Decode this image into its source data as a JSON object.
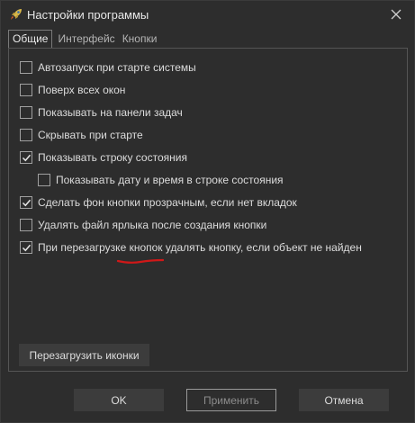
{
  "window": {
    "title": "Настройки программы"
  },
  "tabs": [
    {
      "label": "Общие",
      "active": true
    },
    {
      "label": "Интерфейс",
      "active": false
    },
    {
      "label": "Кнопки",
      "active": false
    }
  ],
  "options": [
    {
      "label": "Автозапуск при старте системы",
      "checked": false
    },
    {
      "label": "Поверх всех окон",
      "checked": false
    },
    {
      "label": "Показывать на панели задач",
      "checked": false
    },
    {
      "label": "Скрывать при старте",
      "checked": false
    },
    {
      "label": "Показывать строку состояния",
      "checked": true
    },
    {
      "label": "Показывать дату и время в строке состояния",
      "checked": false
    },
    {
      "label": "Сделать фон кнопки прозрачным, если нет вкладок",
      "checked": true
    },
    {
      "label": "Удалять файл ярлыка после создания кнопки",
      "checked": false
    },
    {
      "label": "При перезагрузке кнопок удалять кнопку, если объект не найден",
      "checked": true
    }
  ],
  "buttons": {
    "reload_icons": "Перезагрузить иконки",
    "ok": "OK",
    "apply": "Применить",
    "cancel": "Отмена"
  },
  "colors": {
    "background": "#2d2d2d",
    "outer_background": "#1e1e1e",
    "annotation_red": "#d01818"
  }
}
